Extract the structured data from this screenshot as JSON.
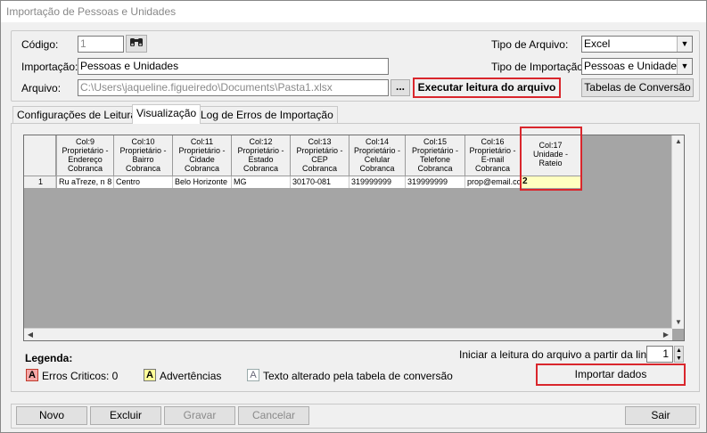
{
  "window": {
    "title": "Importação de Pessoas e Unidades"
  },
  "form": {
    "codigo_label": "Código:",
    "codigo_value": "1",
    "importacao_label": "Importação:",
    "importacao_value": "Pessoas e Unidades",
    "arquivo_label": "Arquivo:",
    "arquivo_value": "C:\\Users\\jaqueline.figueiredo\\Documents\\Pasta1.xlsx",
    "browse_label": "...",
    "executar_label": "Executar leitura do arquivo",
    "tipo_arquivo_label": "Tipo de Arquivo:",
    "tipo_arquivo_value": "Excel",
    "tipo_importacao_label": "Tipo de Importação:",
    "tipo_importacao_value": "Pessoas e Unidades",
    "tabelas_label": "Tabelas de Conversão"
  },
  "tabs": [
    {
      "label": "Configurações de Leitura"
    },
    {
      "label": "Visualização"
    },
    {
      "label": "Log de Erros de  Importação"
    }
  ],
  "grid": {
    "columns": [
      {
        "l1": "Col:9",
        "l2": "Proprietário -",
        "l3": "Endereço",
        "l4": "Cobranca"
      },
      {
        "l1": "Col:10",
        "l2": "Proprietário -",
        "l3": "Bairro",
        "l4": "Cobranca"
      },
      {
        "l1": "Col:11",
        "l2": "Proprietário -",
        "l3": "Cidade",
        "l4": "Cobranca"
      },
      {
        "l1": "Col:12",
        "l2": "Proprietário -",
        "l3": "Estado",
        "l4": "Cobranca"
      },
      {
        "l1": "Col:13",
        "l2": "Proprietário -",
        "l3": "CEP",
        "l4": "Cobranca"
      },
      {
        "l1": "Col:14",
        "l2": "Proprietário -",
        "l3": "Celular",
        "l4": "Cobranca"
      },
      {
        "l1": "Col:15",
        "l2": "Proprietário -",
        "l3": "Telefone",
        "l4": "Cobranca"
      },
      {
        "l1": "Col:16",
        "l2": "Proprietário -",
        "l3": "E-mail",
        "l4": "Cobranca"
      },
      {
        "l1": "Col:17",
        "l2": "Unidade -",
        "l3": "Rateio",
        "l4": ""
      }
    ],
    "rows": [
      {
        "num": "1",
        "cells": [
          "Ru aTreze, n 8",
          "Centro",
          "Belo Horizonte",
          "MG",
          "30170-081",
          "319999999",
          "319999999",
          "prop@email.co",
          "2"
        ]
      }
    ]
  },
  "legend": {
    "title": "Legenda:",
    "erros_letter": "A",
    "erros_label": "Erros Criticos: 0",
    "adv_letter": "A",
    "adv_label": "Advertências",
    "texto_letter": "A",
    "texto_label": "Texto alterado pela tabela de conversão",
    "erros_color": "#f4a7a7",
    "adv_color": "#ffff99"
  },
  "start_line": {
    "label": "Iniciar a leitura do arquivo a partir da linha:",
    "value": "1"
  },
  "importar_label": "Importar dados",
  "footer": {
    "novo": "Novo",
    "excluir": "Excluir",
    "gravar": "Gravar",
    "cancelar": "Cancelar",
    "sair": "Sair"
  }
}
